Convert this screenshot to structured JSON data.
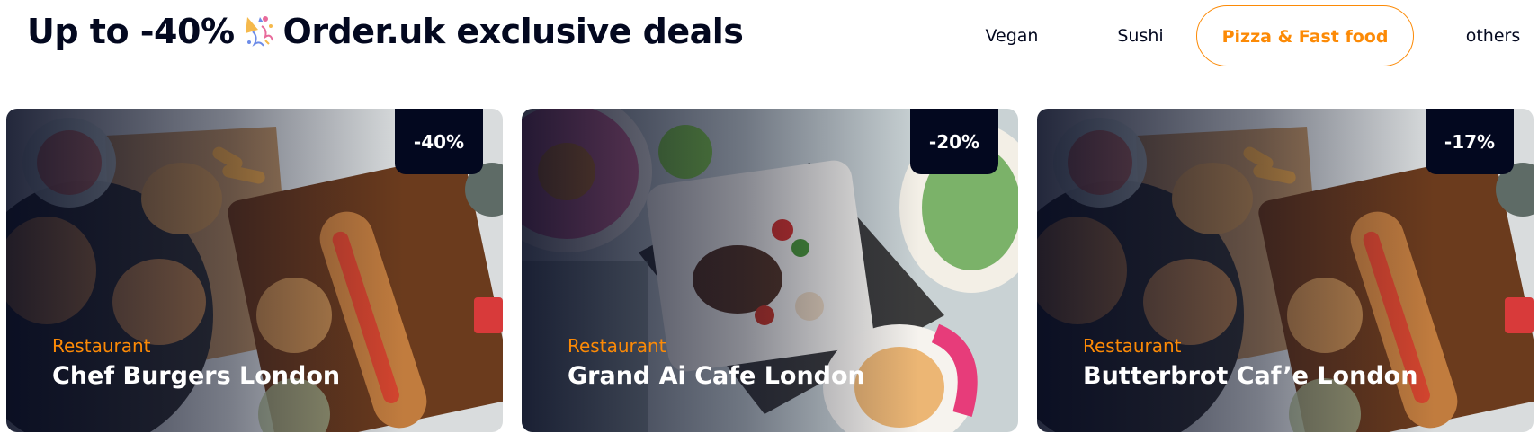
{
  "header": {
    "title_prefix": "Up to -40%",
    "title_suffix": "Order.uk exclusive deals"
  },
  "filters": [
    {
      "label": "Vegan",
      "active": false
    },
    {
      "label": "Sushi",
      "active": false
    },
    {
      "label": "Pizza & Fast food",
      "active": true
    },
    {
      "label": "others",
      "active": false
    }
  ],
  "deals": [
    {
      "category": "Restaurant",
      "name": "Chef Burgers London",
      "discount": "-40%"
    },
    {
      "category": "Restaurant",
      "name": "Grand Ai Cafe London",
      "discount": "-20%"
    },
    {
      "category": "Restaurant",
      "name": "Butterbrot Caf’e London",
      "discount": "-17%"
    }
  ],
  "colors": {
    "accent": "#FC8A06",
    "dark": "#03081F",
    "white": "#FFFFFF"
  },
  "icons": {
    "title_emoji": "party-popper-icon"
  }
}
